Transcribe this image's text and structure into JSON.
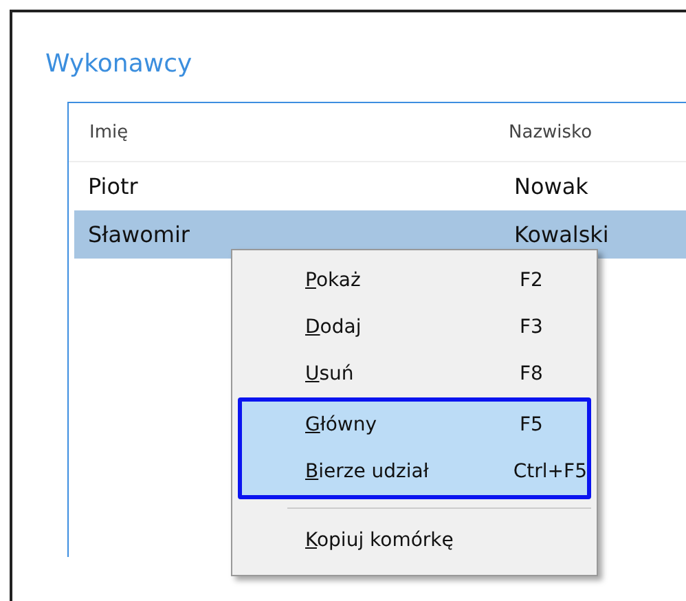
{
  "window": {
    "title": "Wykonawcy"
  },
  "table": {
    "columns": [
      "Imię",
      "Nazwisko"
    ],
    "rows": [
      {
        "cells": [
          "Piotr",
          "Nowak"
        ],
        "selected": false
      },
      {
        "cells": [
          "Sławomir",
          "Kowalski"
        ],
        "selected": true
      }
    ]
  },
  "context_menu": {
    "items": [
      {
        "kind": "item",
        "label": "Pokaż",
        "shortcut": "F2",
        "highlighted": false
      },
      {
        "kind": "item",
        "label": "Dodaj",
        "shortcut": "F3",
        "highlighted": false
      },
      {
        "kind": "item",
        "label": "Usuń",
        "shortcut": "F8",
        "highlighted": false
      },
      {
        "kind": "item",
        "label": "Główny",
        "shortcut": "F5",
        "highlighted": true
      },
      {
        "kind": "item",
        "label": "Bierze udział",
        "shortcut": "Ctrl+F5",
        "highlighted": true
      },
      {
        "kind": "separator"
      },
      {
        "kind": "item",
        "label": "Kopiuj komórkę",
        "highlighted": false
      }
    ]
  }
}
